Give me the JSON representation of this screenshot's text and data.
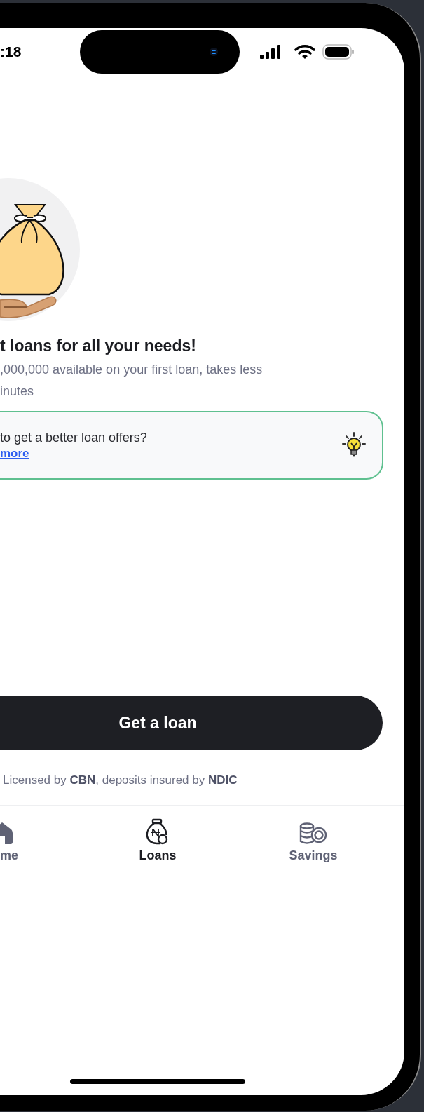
{
  "status_bar": {
    "time": ":18"
  },
  "hero": {
    "title": "t loans for all your needs!",
    "subtitle_lines": [
      ",000,000 available on your first loan, takes less",
      "inutes"
    ]
  },
  "tip_card": {
    "text": "to get a better loan offers?",
    "link": "more"
  },
  "primary_button": {
    "label": "Get a loan"
  },
  "license_note": "Licensed by **CBN**, deposits insured by **NDIC**",
  "tabs": [
    {
      "label": "me",
      "kind": "home",
      "selected": false
    },
    {
      "label": "Loans",
      "kind": "loans",
      "selected": true
    },
    {
      "label": "Savings",
      "kind": "savings",
      "selected": false
    }
  ]
}
